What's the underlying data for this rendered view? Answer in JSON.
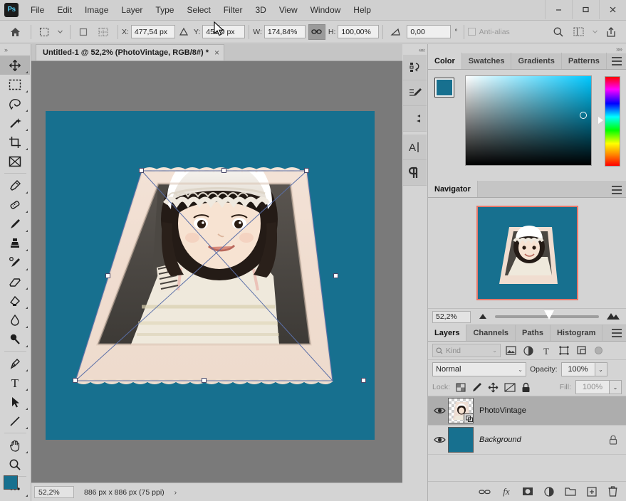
{
  "app": {
    "name": "Adobe Photoshop",
    "logo_text": "Ps"
  },
  "menubar": {
    "items": [
      "File",
      "Edit",
      "Image",
      "Layer",
      "Type",
      "Select",
      "Filter",
      "3D",
      "View",
      "Window",
      "Help"
    ]
  },
  "window_controls": {
    "minimize": "minimize-button",
    "maximize": "maximize-button",
    "close": "close-button"
  },
  "options_bar": {
    "home_icon": "home-icon",
    "transform_icon": "free-transform-icon",
    "preset_arrow": "chevron-down-icon",
    "ref_point_icon": "reference-point-icon",
    "grid_icon": "reference-grid-icon",
    "x_label": "X:",
    "x_value": "477,54 px",
    "delta_icon": "delta-icon",
    "y_label": "Y:",
    "y_value": "451,9 px",
    "w_label": "W:",
    "w_value": "174,84%",
    "link_icon": "link-aspect-ratio-icon",
    "h_label": "H:",
    "h_value": "100,00%",
    "angle_icon": "rotate-angle-icon",
    "angle_value": "0,00",
    "degree_symbol": "°",
    "antialias_label": "Anti-alias",
    "search_icon": "search-icon",
    "arrange_icon": "arrange-documents-icon",
    "workspace_arrow": "chevron-down-icon",
    "share_icon": "share-icon"
  },
  "toolbar": {
    "grip": "»",
    "tools": [
      {
        "name": "move-tool",
        "label": "Move Tool"
      },
      {
        "name": "marquee-tool",
        "label": "Rectangular Marquee Tool"
      },
      {
        "name": "lasso-tool",
        "label": "Lasso Tool"
      },
      {
        "name": "magic-wand-tool",
        "label": "Object Selection Tool"
      },
      {
        "name": "crop-tool",
        "label": "Crop Tool"
      },
      {
        "name": "frame-tool",
        "label": "Frame Tool"
      },
      {
        "name": "eyedropper-tool",
        "label": "Eyedropper Tool"
      },
      {
        "name": "spot-healing-tool",
        "label": "Spot Healing Brush Tool"
      },
      {
        "name": "brush-tool",
        "label": "Brush Tool"
      },
      {
        "name": "clone-stamp-tool",
        "label": "Clone Stamp Tool"
      },
      {
        "name": "history-brush-tool",
        "label": "History Brush Tool"
      },
      {
        "name": "eraser-tool",
        "label": "Eraser Tool"
      },
      {
        "name": "gradient-tool",
        "label": "Gradient Tool"
      },
      {
        "name": "blur-tool",
        "label": "Blur Tool"
      },
      {
        "name": "dodge-tool",
        "label": "Dodge Tool"
      },
      {
        "name": "pen-tool",
        "label": "Pen Tool"
      },
      {
        "name": "type-tool",
        "label": "Horizontal Type Tool"
      },
      {
        "name": "path-selection-tool",
        "label": "Path Selection Tool"
      },
      {
        "name": "line-tool",
        "label": "Line Tool"
      },
      {
        "name": "hand-tool",
        "label": "Hand Tool"
      },
      {
        "name": "zoom-tool",
        "label": "Zoom Tool"
      },
      {
        "name": "edit-toolbar-tool",
        "label": "Edit Toolbar"
      }
    ],
    "foreground_color": "#17708f",
    "background_color": "#ffffff"
  },
  "document": {
    "tab_title": "Untitled-1 @ 52,2% (PhotoVintage, RGB/8#) *",
    "close_glyph": "×",
    "canvas_background": "#17708f",
    "workspace_background": "#7a7a7a"
  },
  "status_bar": {
    "zoom": "52,2%",
    "doc_info": "886 px x 886 px (75 ppi)",
    "expand_glyph": "›"
  },
  "rail": {
    "grip": "««",
    "buttons": [
      {
        "name": "history-panel-icon",
        "label": "History"
      },
      {
        "name": "brush-settings-icon",
        "label": "Brush Settings"
      },
      {
        "name": "brushes-panel-icon",
        "label": "Brushes"
      },
      {
        "name": "character-panel-icon",
        "label": "Character"
      },
      {
        "name": "paragraph-panel-icon",
        "label": "Paragraph"
      }
    ]
  },
  "color_panel": {
    "grip": "»»",
    "tabs": [
      {
        "label": "Color",
        "active": true
      },
      {
        "label": "Swatches",
        "active": false
      },
      {
        "label": "Gradients",
        "active": false
      },
      {
        "label": "Patterns",
        "active": false
      }
    ],
    "menu_icon": "panel-menu-icon",
    "foreground_color": "#17708f",
    "background_color": "#ffffff"
  },
  "navigator_panel": {
    "tabs": [
      {
        "label": "Navigator",
        "active": true
      }
    ],
    "menu_icon": "panel-menu-icon",
    "zoom_value": "52,2%",
    "zoom_out_icon": "zoom-out-icon",
    "zoom_in_icon": "zoom-in-icon",
    "view_box_color": "#e8786a"
  },
  "layers_panel": {
    "tabs": [
      {
        "label": "Layers",
        "active": true
      },
      {
        "label": "Channels",
        "active": false
      },
      {
        "label": "Paths",
        "active": false
      },
      {
        "label": "Histogram",
        "active": false
      }
    ],
    "menu_icon": "panel-menu-icon",
    "filter": {
      "search_icon": "search-icon",
      "kind_label": "Kind",
      "chevron": "⌄",
      "filter_buttons": [
        {
          "name": "filter-pixel-icon"
        },
        {
          "name": "filter-adjustment-icon"
        },
        {
          "name": "filter-type-icon"
        },
        {
          "name": "filter-shape-icon"
        },
        {
          "name": "filter-smart-object-icon"
        }
      ],
      "toggle_name": "filter-toggle-switch"
    },
    "blend_mode": "Normal",
    "blend_chevron": "⌄",
    "opacity_label": "Opacity:",
    "opacity_value": "100%",
    "opacity_chevron": "⌄",
    "lock_label": "Lock:",
    "lock_buttons": [
      {
        "name": "lock-transparent-pixels-icon"
      },
      {
        "name": "lock-image-pixels-icon"
      },
      {
        "name": "lock-position-icon"
      },
      {
        "name": "lock-artboard-nesting-icon"
      },
      {
        "name": "lock-all-icon"
      }
    ],
    "fill_label": "Fill:",
    "fill_value": "100%",
    "fill_chevron": "⌄",
    "layers": [
      {
        "name": "PhotoVintage",
        "selected": true,
        "visible": true,
        "italic": false,
        "locked": false,
        "smart_object": true,
        "thumb_type": "photo"
      },
      {
        "name": "Background",
        "selected": false,
        "visible": true,
        "italic": true,
        "locked": true,
        "smart_object": false,
        "thumb_type": "solid",
        "thumb_color": "#17708f"
      }
    ],
    "bottom_buttons": [
      {
        "name": "link-layers-button",
        "label": "Link layers"
      },
      {
        "name": "layer-style-button",
        "label": "Add a layer style"
      },
      {
        "name": "layer-mask-button",
        "label": "Add layer mask"
      },
      {
        "name": "adjustment-layer-button",
        "label": "New fill or adjustment layer"
      },
      {
        "name": "new-group-button",
        "label": "Create a new group"
      },
      {
        "name": "new-layer-button",
        "label": "Create a new layer"
      },
      {
        "name": "delete-layer-button",
        "label": "Delete layer"
      }
    ]
  },
  "colors": {
    "teal": "#17708f",
    "panel_bg": "#d4d4d4",
    "panel_tab_bg": "#c5c5c5",
    "canvas_bg": "#7a7a7a",
    "selection_blue": "#5a6fa8",
    "navigator_box": "#e8786a"
  }
}
